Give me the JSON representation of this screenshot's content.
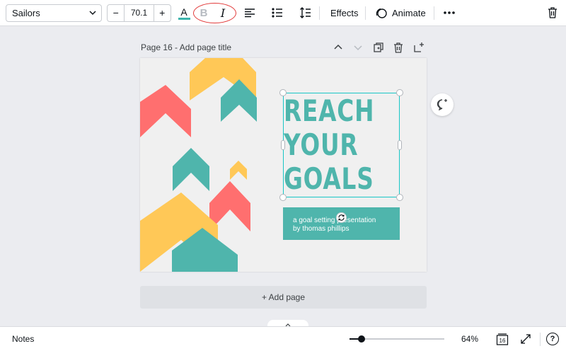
{
  "toolbar": {
    "font_name": "Sailors",
    "font_size": "70.1",
    "decrease_label": "−",
    "increase_label": "+",
    "text_color_letter": "A",
    "text_color_swatch": "#3cb4ac",
    "bold_letter": "B",
    "italic_letter": "I",
    "effects_label": "Effects",
    "animate_label": "Animate",
    "icons": [
      "chevron-down-icon",
      "text-color-icon",
      "bold-icon",
      "italic-icon",
      "align-left-icon",
      "list-icon",
      "spacing-icon",
      "animate-icon",
      "more-icon",
      "trash-icon"
    ]
  },
  "page": {
    "title": "Page 16 - Add page title",
    "icons": [
      "chevron-up-icon",
      "chevron-down-icon",
      "duplicate-icon",
      "trash-icon",
      "add-page-icon"
    ]
  },
  "design": {
    "headline_lines": [
      "REACH",
      "YOUR",
      "GOALS"
    ],
    "subtitle": "a goal setting presentation\nby thomas phillips",
    "colors": {
      "teal": "#4fb5ac",
      "coral": "#ff6f6f",
      "yellow": "#ffc857",
      "background": "#f0f0f0"
    }
  },
  "add_page_label": "+ Add page",
  "bottom": {
    "notes_label": "Notes",
    "zoom_value": "64%",
    "zoom_fraction": 0.07,
    "page_count": "16",
    "help_label": "?"
  },
  "colors": {
    "selection": "#19c6c6",
    "annotation_oval": "#e23b3b"
  }
}
